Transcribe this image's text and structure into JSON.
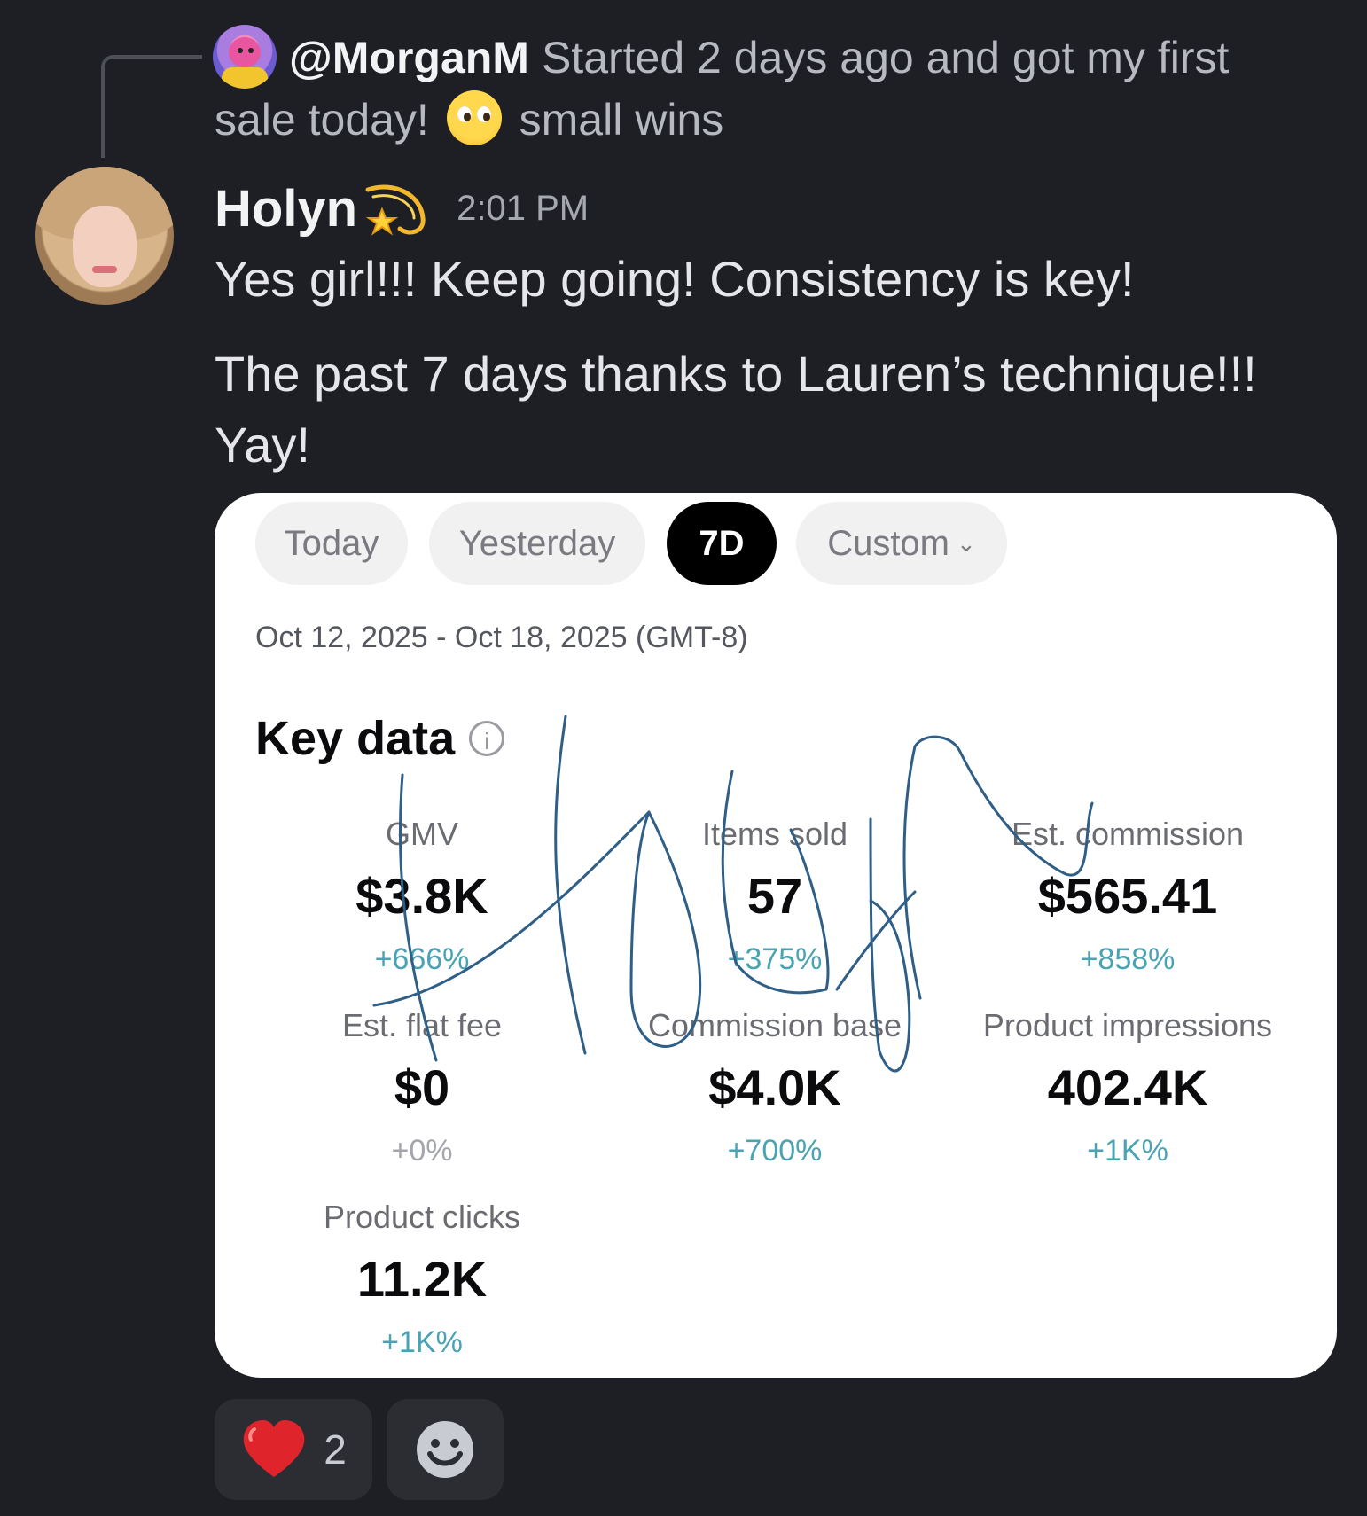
{
  "reply": {
    "username": "@MorganM",
    "text_before_emoji": "Started 2 days ago and got my first sale today!",
    "emoji": "pleading-face",
    "text_after_emoji": "small wins"
  },
  "message": {
    "author": "Holyn",
    "author_badge": "comet-icon",
    "timestamp": "2:01 PM",
    "line1": "Yes girl!!! Keep going! Consistency is key!",
    "line2": "The past 7 days thanks to Lauren’s technique!!! Yay!"
  },
  "card": {
    "filters": [
      {
        "label": "Today",
        "active": false
      },
      {
        "label": "Yesterday",
        "active": false
      },
      {
        "label": "7D",
        "active": true
      },
      {
        "label": "Custom",
        "active": false,
        "dropdown": true
      }
    ],
    "date_range": "Oct 12, 2025 - Oct 18, 2025 (GMT-8)",
    "section_title": "Key data",
    "metrics": [
      {
        "label": "GMV",
        "value": "$3.8K",
        "change": "+666%"
      },
      {
        "label": "Items sold",
        "value": "57",
        "change": "+375%"
      },
      {
        "label": "Est. commission",
        "value": "$565.41",
        "change": "+858%"
      },
      {
        "label": "Est. flat fee",
        "value": "$0",
        "change": "+0%"
      },
      {
        "label": "Commission base",
        "value": "$4.0K",
        "change": "+700%"
      },
      {
        "label": "Product impressions",
        "value": "402.4K",
        "change": "+1K%"
      },
      {
        "label": "Product clicks",
        "value": "11.2K",
        "change": "+1K%"
      }
    ],
    "signature_color": "#2f5e86",
    "accent_color": "#4aa3b3"
  },
  "reactions": [
    {
      "emoji": "heart-icon",
      "count": "2"
    }
  ],
  "colors": {
    "background": "#1e1f24",
    "reaction_bg": "#2b2d33"
  }
}
